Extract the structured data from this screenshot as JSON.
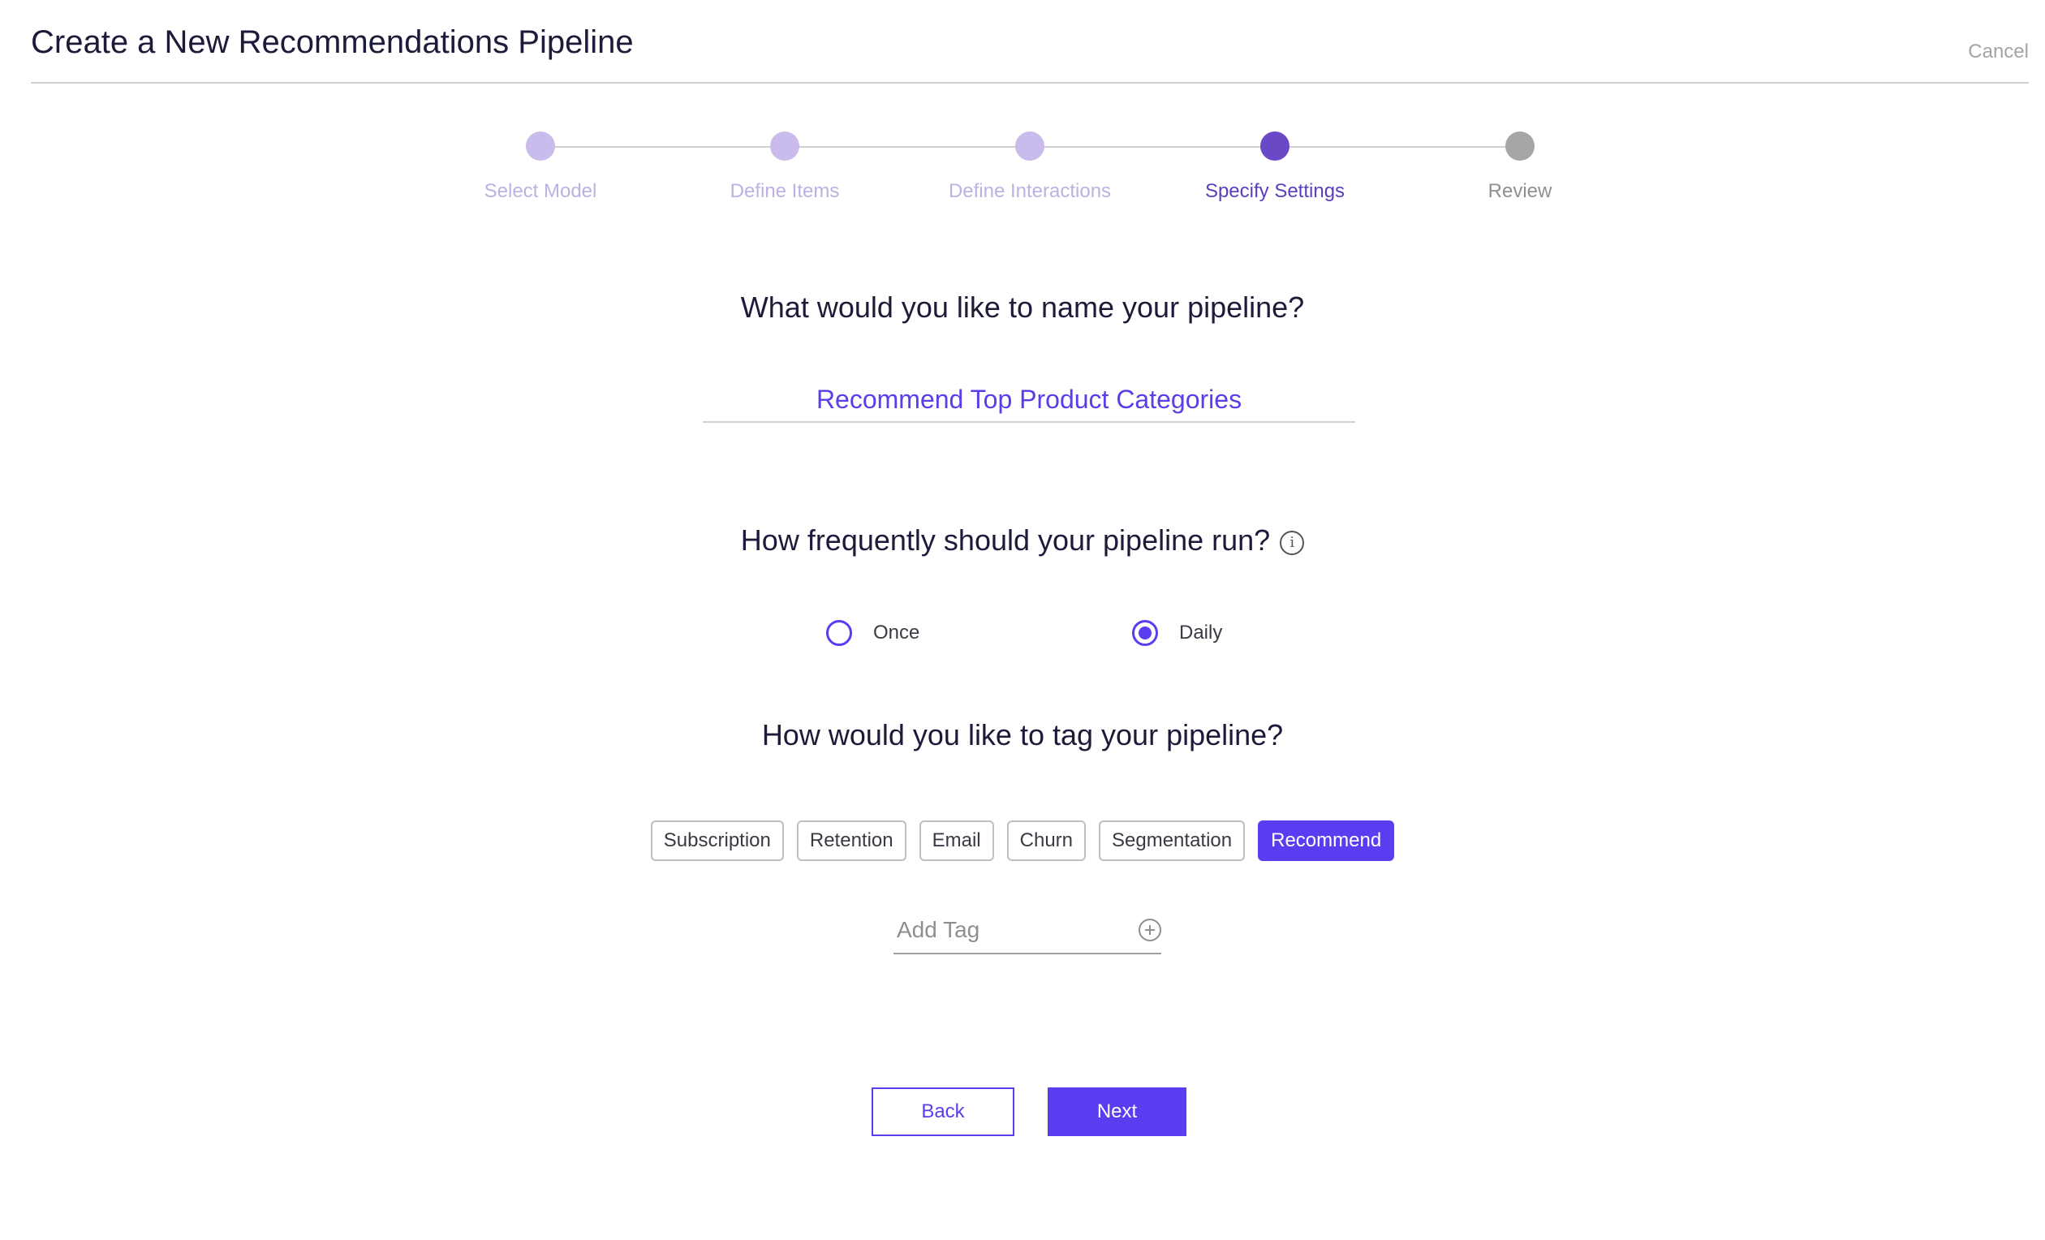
{
  "header": {
    "title": "Create a New Recommendations Pipeline",
    "cancel_label": "Cancel"
  },
  "stepper": {
    "steps": [
      {
        "label": "Select Model",
        "state": "done"
      },
      {
        "label": "Define Items",
        "state": "done"
      },
      {
        "label": "Define Interactions",
        "state": "done"
      },
      {
        "label": "Specify Settings",
        "state": "active"
      },
      {
        "label": "Review",
        "state": "todo"
      }
    ]
  },
  "name_section": {
    "question": "What would you like to name your pipeline?",
    "value": "Recommend Top Product Categories"
  },
  "frequency_section": {
    "question": "How frequently should your pipeline run?",
    "info_icon": "info-icon",
    "info_glyph": "i",
    "options": [
      {
        "label": "Once",
        "checked": false
      },
      {
        "label": "Daily",
        "checked": true
      }
    ]
  },
  "tag_section": {
    "question": "How would you like to tag your pipeline?",
    "tags": [
      {
        "label": "Subscription",
        "selected": false
      },
      {
        "label": "Retention",
        "selected": false
      },
      {
        "label": "Email",
        "selected": false
      },
      {
        "label": "Churn",
        "selected": false
      },
      {
        "label": "Segmentation",
        "selected": false
      },
      {
        "label": "Recommend",
        "selected": true
      }
    ],
    "add_tag_placeholder": "Add Tag",
    "add_tag_value": ""
  },
  "actions": {
    "back_label": "Back",
    "next_label": "Next"
  },
  "colors": {
    "accent": "#5a3df0",
    "step_active": "#6a49c7",
    "step_done": "#c9bbeb",
    "step_todo": "#a6a6a9"
  }
}
